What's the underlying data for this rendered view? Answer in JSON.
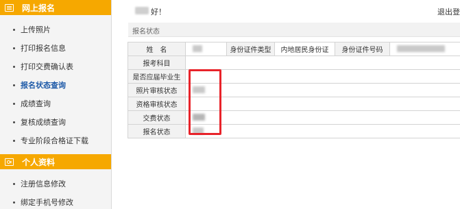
{
  "sidebar": {
    "section1_title": "网上报名",
    "section1_items": [
      {
        "label": "上传照片"
      },
      {
        "label": "打印报名信息"
      },
      {
        "label": "打印交费确认表"
      },
      {
        "label": "报名状态查询"
      },
      {
        "label": "成绩查询"
      },
      {
        "label": "复核成绩查询"
      },
      {
        "label": "专业阶段合格证下载"
      }
    ],
    "active_item": "报名状态查询",
    "section2_title": "个人资料",
    "section2_items": [
      {
        "label": "注册信息修改"
      },
      {
        "label": "绑定手机号修改"
      }
    ],
    "icons": [
      "apply-icon",
      "profile-icon"
    ],
    "accent_color": "#f6a800",
    "active_color": "#1e5aa8"
  },
  "topbar": {
    "greeting_suffix": "好！",
    "logout_label": "退出登录"
  },
  "panel": {
    "title": "报名状态",
    "rows": {
      "name_label": "姓名",
      "id_type_label": "身份证件类型",
      "id_type_value": "内地居民身份证",
      "id_number_label": "身份证件号码",
      "subjects_label": "报考科目",
      "graduate_label": "是否应届毕业生",
      "photo_review_label": "照片审核状态",
      "qualification_review_label": "资格审核状态",
      "payment_label": "交费状态",
      "registration_label": "报名状态"
    }
  },
  "highlight_color": "#e8232a"
}
